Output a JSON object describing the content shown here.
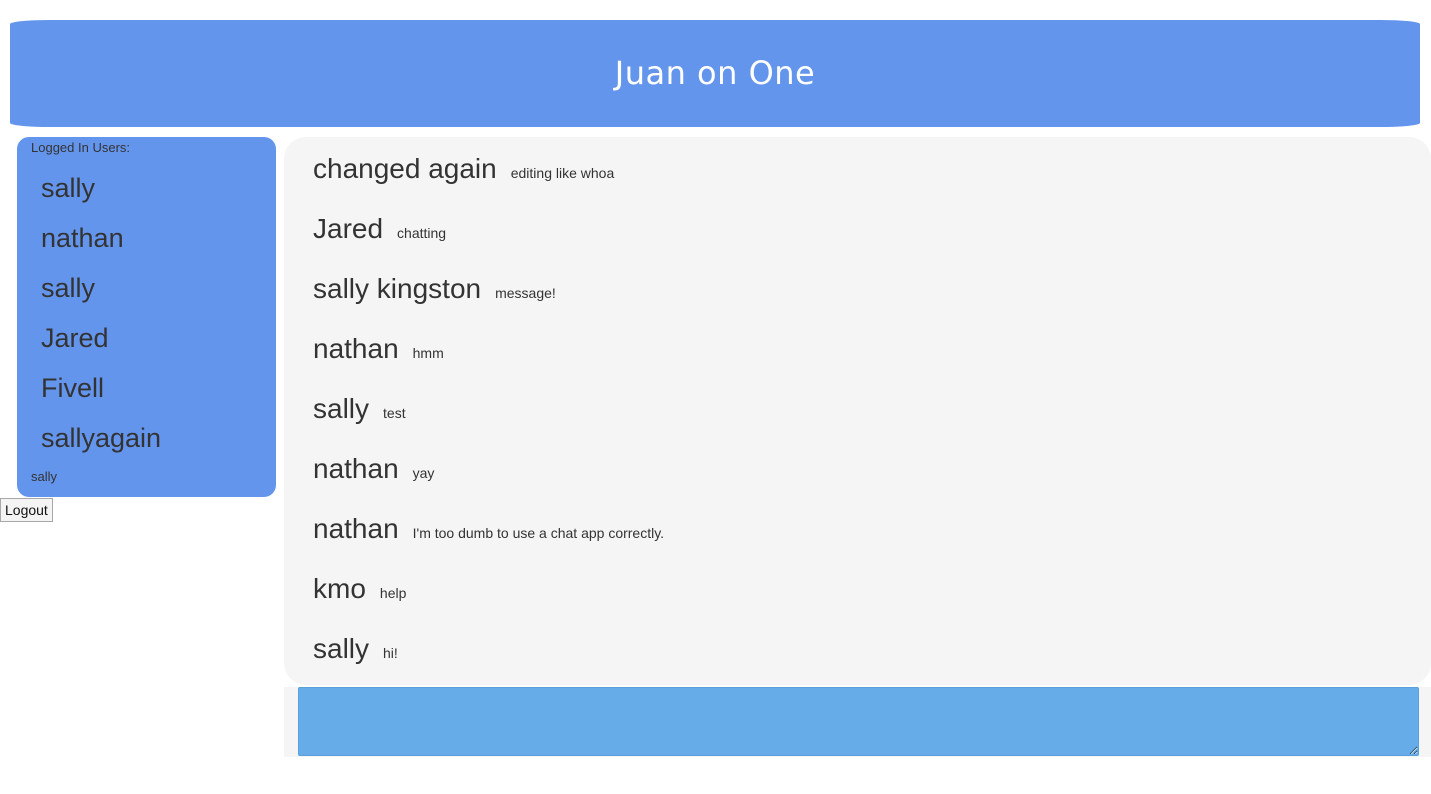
{
  "header": {
    "title": "Juan on One"
  },
  "sidebar": {
    "heading": "Logged In Users:",
    "users": [
      "sally",
      "nathan",
      "sally",
      "Jared",
      "Fivell",
      "sallyagain"
    ],
    "current_user": "sally"
  },
  "logout": {
    "label": "Logout"
  },
  "messages": [
    {
      "author": "changed again",
      "text": "editing like whoa"
    },
    {
      "author": "Jared",
      "text": "chatting"
    },
    {
      "author": "sally kingston",
      "text": "message!"
    },
    {
      "author": "nathan",
      "text": "hmm"
    },
    {
      "author": "sally",
      "text": "test"
    },
    {
      "author": "nathan",
      "text": "yay"
    },
    {
      "author": "nathan",
      "text": "I'm too dumb to use a chat app correctly."
    },
    {
      "author": "kmo",
      "text": "help"
    },
    {
      "author": "sally",
      "text": "hi!"
    }
  ],
  "composer": {
    "value": ""
  },
  "colors": {
    "header_bg": "#6495ed",
    "sidebar_bg": "#6495ed",
    "chat_bg": "#f5f5f5",
    "input_bg": "#66ace8"
  }
}
